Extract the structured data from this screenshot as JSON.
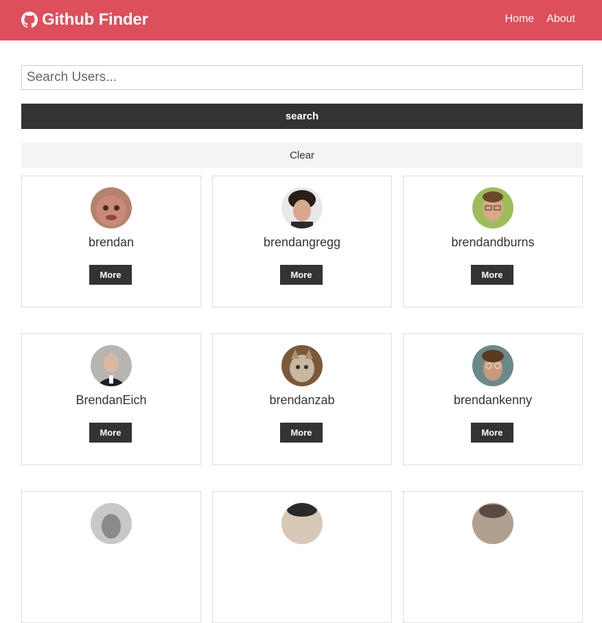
{
  "navbar": {
    "brand": "Github Finder",
    "brand_icon": "github-icon",
    "links": [
      "Home",
      "About"
    ],
    "color": "#dc4f5b"
  },
  "search": {
    "placeholder": "Search Users...",
    "value": "",
    "button_label": "search",
    "clear_label": "Clear"
  },
  "users": [
    {
      "login": "brendan",
      "more_label": "More",
      "avatar_color": "#a0685a"
    },
    {
      "login": "brendangregg",
      "more_label": "More",
      "avatar_color": "#4a3a32"
    },
    {
      "login": "brendandburns",
      "more_label": "More",
      "avatar_color": "#8ba74e"
    },
    {
      "login": "BrendanEich",
      "more_label": "More",
      "avatar_color": "#8a8a8a"
    },
    {
      "login": "brendanzab",
      "more_label": "More",
      "avatar_color": "#8a6a48"
    },
    {
      "login": "brendankenny",
      "more_label": "More",
      "avatar_color": "#5a6a6a"
    },
    {
      "login": "",
      "more_label": "",
      "avatar_color": "#9a9a9a"
    },
    {
      "login": "",
      "more_label": "",
      "avatar_color": "#3a3a3a"
    },
    {
      "login": "",
      "more_label": "",
      "avatar_color": "#6a5a50"
    }
  ]
}
